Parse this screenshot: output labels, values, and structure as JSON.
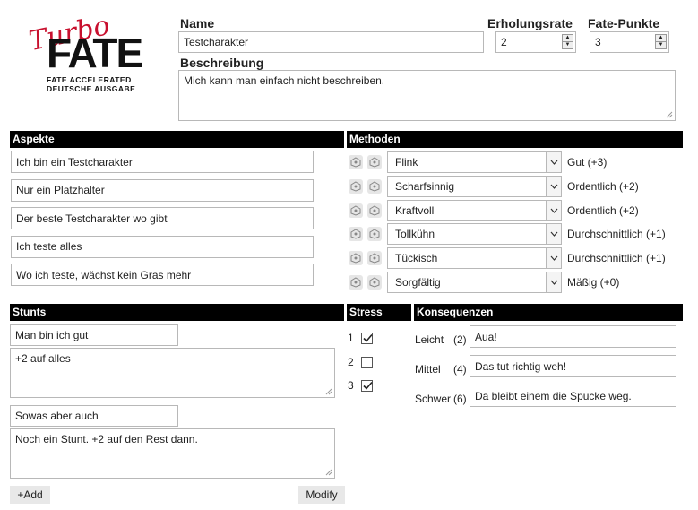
{
  "logo": {
    "script": "Turbo",
    "word": "FATE",
    "line1": "FATE ACCELERATED",
    "line2": "DEUTSCHE AUSGABE"
  },
  "header": {
    "name_label": "Name",
    "name_value": "Testcharakter",
    "recovery_label": "Erholungsrate",
    "recovery_value": "2",
    "fate_label": "Fate-Punkte",
    "fate_value": "3",
    "description_label": "Beschreibung",
    "description_value": "Mich kann man einfach nicht beschreiben."
  },
  "aspects": {
    "title": "Aspekte",
    "items": [
      "Ich bin ein Testcharakter",
      "Nur ein Platzhalter",
      "Der beste Testcharakter wo gibt",
      "Ich teste alles",
      "Wo ich teste, wächst kein Gras mehr"
    ]
  },
  "methods": {
    "title": "Methoden",
    "items": [
      {
        "name": "Flink",
        "rating": "Gut (+3)"
      },
      {
        "name": "Scharfsinnig",
        "rating": "Ordentlich (+2)"
      },
      {
        "name": "Kraftvoll",
        "rating": "Ordentlich (+2)"
      },
      {
        "name": "Tollkühn",
        "rating": "Durchschnittlich (+1)"
      },
      {
        "name": "Tückisch",
        "rating": "Durchschnittlich (+1)"
      },
      {
        "name": "Sorgfältig",
        "rating": "Mäßig (+0)"
      }
    ]
  },
  "stunts": {
    "title": "Stunts",
    "items": [
      {
        "name": "Man bin ich gut",
        "description": "+2 auf alles"
      },
      {
        "name": "Sowas aber auch",
        "description": "Noch ein Stunt. +2 auf den Rest dann."
      }
    ],
    "add_label": "+Add",
    "modify_label": "Modify"
  },
  "stress": {
    "title": "Stress",
    "boxes": [
      {
        "label": "1",
        "checked": true
      },
      {
        "label": "2",
        "checked": false
      },
      {
        "label": "3",
        "checked": true
      }
    ]
  },
  "consequences": {
    "title": "Konsequenzen",
    "items": [
      {
        "label": "Leicht",
        "value": "(2)",
        "text": "Aua!"
      },
      {
        "label": "Mittel",
        "value": "(4)",
        "text": "Das tut richtig weh!"
      },
      {
        "label": "Schwer",
        "value": "(6)",
        "text": "Da bleibt einem die Spucke weg."
      }
    ]
  },
  "colors": {
    "accent": "#c8102e",
    "bar": "#000000"
  }
}
